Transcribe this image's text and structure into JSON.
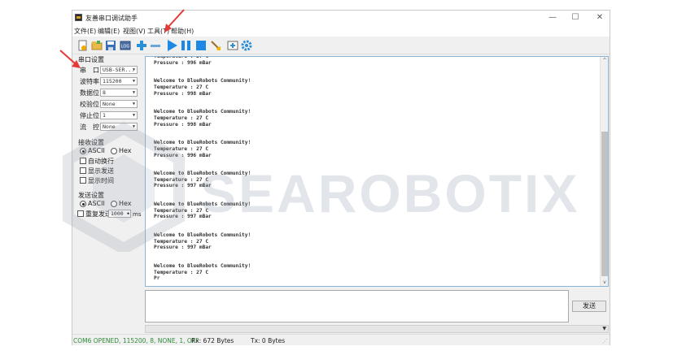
{
  "window": {
    "title": "友善串口调试助手",
    "minimize": "—",
    "maximize": "☐",
    "close": "✕"
  },
  "menu": [
    "文件(E)",
    "编辑(E)",
    "视图(V)",
    "工具(T)",
    "帮助(H)"
  ],
  "toolbar_icons": [
    "new-icon",
    "open-icon",
    "save-icon",
    "log-icon",
    "add-icon",
    "remove-icon",
    "play-icon",
    "pause-icon",
    "stop-icon",
    "clear-icon",
    "add-window-icon",
    "settings-icon"
  ],
  "port_settings": {
    "title": "串口设置",
    "rows": [
      {
        "label": "串　口",
        "value": "USB-SER..."
      },
      {
        "label": "波特率",
        "value": "115200"
      },
      {
        "label": "数据位",
        "value": "8"
      },
      {
        "label": "校验位",
        "value": "None"
      },
      {
        "label": "停止位",
        "value": "1"
      },
      {
        "label": "流　控",
        "value": "None"
      }
    ]
  },
  "receive_settings": {
    "title": "接收设置",
    "ascii": "ASCII",
    "hex": "Hex",
    "options": [
      "自动换行",
      "显示发送",
      "显示时间"
    ]
  },
  "send_settings": {
    "title": "发送设置",
    "ascii": "ASCII",
    "hex": "Hex",
    "repeat": "重复发送",
    "interval": "1000",
    "unit": "ms"
  },
  "receive_text": "Temperature : 27 C\nPressure : 996 mBar\n\n\nWelcome to BlueRobots Community!\nTemperature : 27 C\nPressure : 998 mBar\n\n\nWelcome to BlueRobots Community!\nTemperature : 27 C\nPressure : 998 mBar\n\n\nWelcome to BlueRobots Community!\nTemperature : 27 C\nPressure : 996 mBar\n\n\nWelcome to BlueRobots Community!\nTemperature : 27 C\nPressure : 997 mBar\n\n\nWelcome to BlueRobots Community!\nTemperature : 27 C\nPressure : 997 mBar\n\n\nWelcome to BlueRobots Community!\nTemperature : 27 C\nPressure : 997 mBar\n\n\nWelcome to BlueRobots Community!\nTemperature : 27 C\nPr",
  "send_button": "发送",
  "status": {
    "port": "COM6 OPENED, 115200, 8, NONE, 1, OFF",
    "rx": "Rx: 672 Bytes",
    "tx": "Tx: 0 Bytes"
  },
  "watermark": "SEAROBOTIX",
  "colors": {
    "status_port": "#2e8b3a",
    "play_blue": "#1e88e5",
    "annotation_red": "#e53935"
  }
}
